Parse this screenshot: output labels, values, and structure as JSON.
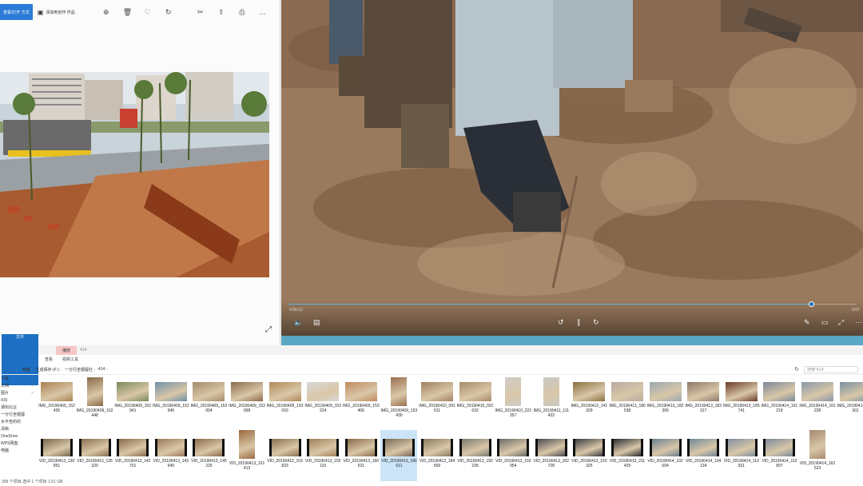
{
  "photos": {
    "slideshow_label": "查看/打开 方式",
    "add_to_album": "添加到创作 作品",
    "toolbar_icons": [
      "zoom-icon",
      "delete-icon",
      "favorite-icon",
      "rotate-icon",
      "edit-icon",
      "share-icon",
      "print-icon",
      "more-icon"
    ],
    "toolbar_glyphs": [
      "⊕",
      "🗑",
      "♡",
      "↻",
      "✂",
      "⇪",
      "⎙",
      "…"
    ],
    "expand_glyph": "⤢"
  },
  "player": {
    "time_current": "0:06:12",
    "time_end": "0:07",
    "progress": 0.92,
    "colors": {
      "seek": "#5ab4e8",
      "strip": "#5aa7c4"
    }
  },
  "explorer": {
    "tabs": {
      "context": "播放",
      "context_secondary": "414"
    },
    "ribbon": [
      "文件",
      "主页",
      "共享",
      "查看",
      "视频工具"
    ],
    "breadcrumbs": [
      "电脑",
      "生成保存 (F:)",
      "一分行坐婚擅社",
      "414"
    ],
    "search_placeholder": "搜索\"414\"",
    "nav_items": [
      {
        "label": "下载",
        "pin": "✓"
      },
      {
        "label": "文档",
        "pin": "✓"
      },
      {
        "label": "图片",
        "pin": "✓"
      },
      {
        "label": "415",
        "pin": ""
      },
      {
        "label": "谭剑北业",
        "pin": ""
      },
      {
        "label": "一分行坐婚擅",
        "pin": ""
      },
      {
        "label": "水平坐的的",
        "pin": ""
      },
      {
        "label": "清晰",
        "pin": ""
      },
      {
        "label": "OneDrive",
        "pin": ""
      },
      {
        "label": "WPS网盘",
        "pin": ""
      },
      {
        "label": "电脑",
        "pin": ""
      }
    ],
    "status": "259 个项目 选中 1 个项目 1.51 GB",
    "row1": [
      {
        "name": "IMG_20190409_152435",
        "kind": "land",
        "c": "#a9824f"
      },
      {
        "name": "IMG_20190409_152448",
        "kind": "port",
        "c": "#8a6a4a"
      },
      {
        "name": "IMG_20190409_152941",
        "kind": "land",
        "c": "#7a8a5a"
      },
      {
        "name": "IMG_20190409_152949",
        "kind": "land",
        "c": "#6f8fa8"
      },
      {
        "name": "IMG_20190409_153004",
        "kind": "land",
        "c": "#a38a6a"
      },
      {
        "name": "IMG_20190409_153008",
        "kind": "land",
        "c": "#8b6b4b"
      },
      {
        "name": "IMG_20190409_153016",
        "kind": "land",
        "c": "#b08a5a"
      },
      {
        "name": "IMG_20190409_153224",
        "kind": "land",
        "c": "#d8d8d8"
      },
      {
        "name": "IMG_20190409_153406",
        "kind": "land",
        "c": "#c08a60"
      },
      {
        "name": "IMG_20190409_153430",
        "kind": "port",
        "c": "#9a7050"
      },
      {
        "name": "IMG_20190410_091611",
        "kind": "land",
        "c": "#a08060"
      },
      {
        "name": "IMG_20190410_091632",
        "kind": "land",
        "c": "#a88a68"
      },
      {
        "name": "IMG_20190410_222357",
        "kind": "port",
        "c": "#d0ccc8"
      },
      {
        "name": "IMG_20190411_111433",
        "kind": "port",
        "c": "#c8c8c4"
      },
      {
        "name": "IMG_20190413_141329",
        "kind": "land",
        "c": "#8a7040"
      },
      {
        "name": "IMG_20190413_180538",
        "kind": "land",
        "c": "#b8aaa0"
      },
      {
        "name": "IMG_20190413_182306",
        "kind": "land",
        "c": "#9aa8b0"
      },
      {
        "name": "IMG_20190413_182317",
        "kind": "land",
        "c": "#8a7868"
      },
      {
        "name": "IMG_20190413_185741",
        "kind": "land",
        "c": "#6a3a28"
      },
      {
        "name": "IMG_20190414_161219",
        "kind": "land",
        "c": "#7a8898"
      },
      {
        "name": "IMG_20190414_161228",
        "kind": "land",
        "c": "#8898a8"
      },
      {
        "name": "IMG_20190414_161301",
        "kind": "land",
        "c": "#7890a0"
      }
    ],
    "row2": [
      {
        "name": "VID_20190413_130851",
        "kind": "video",
        "c": "#7a6850",
        "sel": false
      },
      {
        "name": "VID_20190413_135320",
        "kind": "video",
        "c": "#8a7050",
        "sel": false
      },
      {
        "name": "VID_20190413_142701",
        "kind": "video",
        "c": "#8a6a48",
        "sel": false
      },
      {
        "name": "VID_20190413_143649",
        "kind": "video",
        "c": "#9a7a58",
        "sel": false
      },
      {
        "name": "VID_20190413_145225",
        "kind": "video",
        "c": "#8a6a48",
        "sel": false
      },
      {
        "name": "VID_20190413_151413",
        "kind": "port",
        "c": "#9a6a40",
        "sel": false
      },
      {
        "name": "VID_20190413_153823",
        "kind": "video",
        "c": "#8a7050",
        "sel": false
      },
      {
        "name": "VID_20190413_155110",
        "kind": "video",
        "c": "#a08058",
        "sel": false
      },
      {
        "name": "VID_20190413_160521",
        "kind": "video",
        "c": "#8a6a48",
        "sel": false
      },
      {
        "name": "VID_20190413_180611",
        "kind": "video",
        "c": "#7a6a58",
        "sel": true
      },
      {
        "name": "VID_20190413_184659",
        "kind": "video",
        "c": "#8a7a60",
        "sel": false
      },
      {
        "name": "VID_20190413_192235",
        "kind": "video",
        "c": "#7a7a70",
        "sel": false
      },
      {
        "name": "VID_20190413_193954",
        "kind": "video",
        "c": "#6a6a68",
        "sel": false
      },
      {
        "name": "VID_20190413_202728",
        "kind": "video",
        "c": "#4a4a50",
        "sel": false
      },
      {
        "name": "VID_20190413_210325",
        "kind": "video",
        "c": "#3a3a40",
        "sel": false
      },
      {
        "name": "VID_20190413_211429",
        "kind": "video",
        "c": "#2a2a30",
        "sel": false
      },
      {
        "name": "VID_20190414_102604",
        "kind": "video",
        "c": "#6a8090",
        "sel": false
      },
      {
        "name": "VID_20190414_104134",
        "kind": "video",
        "c": "#708898",
        "sel": false
      },
      {
        "name": "VID_20190414_110931",
        "kind": "video",
        "c": "#8090a0",
        "sel": false
      },
      {
        "name": "VID_20190414_112807",
        "kind": "video",
        "c": "#7a8a98",
        "sel": false
      },
      {
        "name": "VID_20190414_162523",
        "kind": "port",
        "c": "#a88a70",
        "sel": false
      }
    ]
  }
}
